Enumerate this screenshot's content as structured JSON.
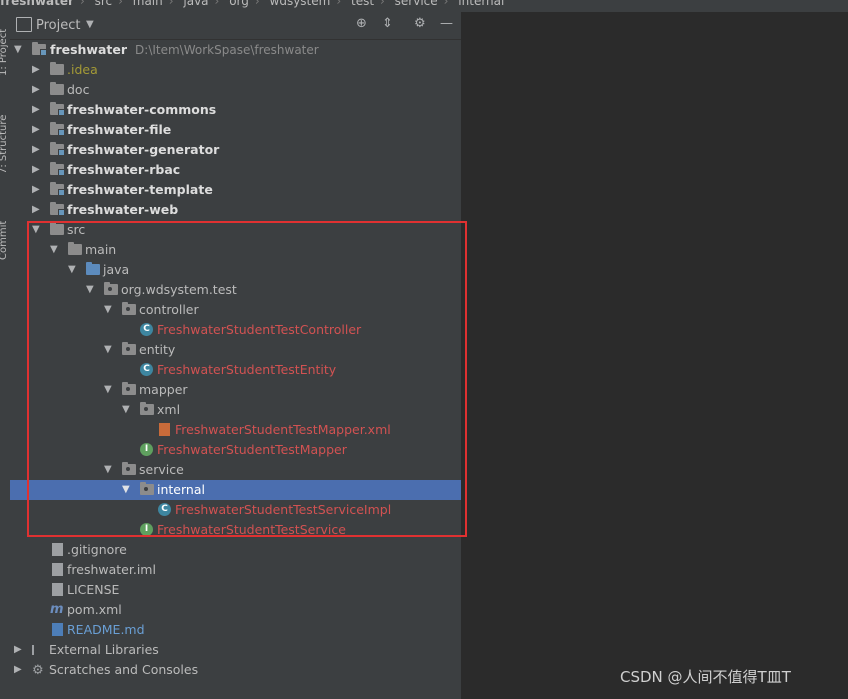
{
  "breadcrumb": [
    "freshwater",
    "src",
    "main",
    "java",
    "org",
    "wdsystem",
    "test",
    "service",
    "internal"
  ],
  "toolstrip": {
    "project_tab": "1: Project",
    "structure_tab": "7: Structure",
    "commit_tab": "Commit"
  },
  "panel": {
    "title": "Project",
    "dropdown_icon": "chevron-down-icon",
    "icons": [
      "crosshair-icon",
      "collapse-icon",
      "gear-icon",
      "minimize-icon"
    ]
  },
  "tree": {
    "root": {
      "name": "freshwater",
      "path": "D:\\Item\\WorkSpase\\freshwater"
    },
    "modules": [
      ".idea",
      "doc",
      "freshwater-commons",
      "freshwater-file",
      "freshwater-generator",
      "freshwater-rbac",
      "freshwater-template",
      "freshwater-web"
    ],
    "src": "src",
    "main": "main",
    "java": "java",
    "package": "org.wdsystem.test",
    "controller": "controller",
    "controller_class": "FreshwaterStudentTestController",
    "entity": "entity",
    "entity_class": "FreshwaterStudentTestEntity",
    "mapper": "mapper",
    "xml": "xml",
    "mapper_xml": "FreshwaterStudentTestMapper.xml",
    "mapper_interface": "FreshwaterStudentTestMapper",
    "service": "service",
    "internal": "internal",
    "service_impl": "FreshwaterStudentTestServiceImpl",
    "service_interface": "FreshwaterStudentTestService",
    "files": [
      ".gitignore",
      "freshwater.iml",
      "LICENSE",
      "pom.xml",
      "README.md"
    ],
    "external_libraries": "External Libraries",
    "scratches": "Scratches and Consoles"
  },
  "watermark": "CSDN @人间不值得T皿T",
  "colors": {
    "selection": "#4b6eaf",
    "highlight_box": "#e03131",
    "modified_file": "#d25252"
  }
}
